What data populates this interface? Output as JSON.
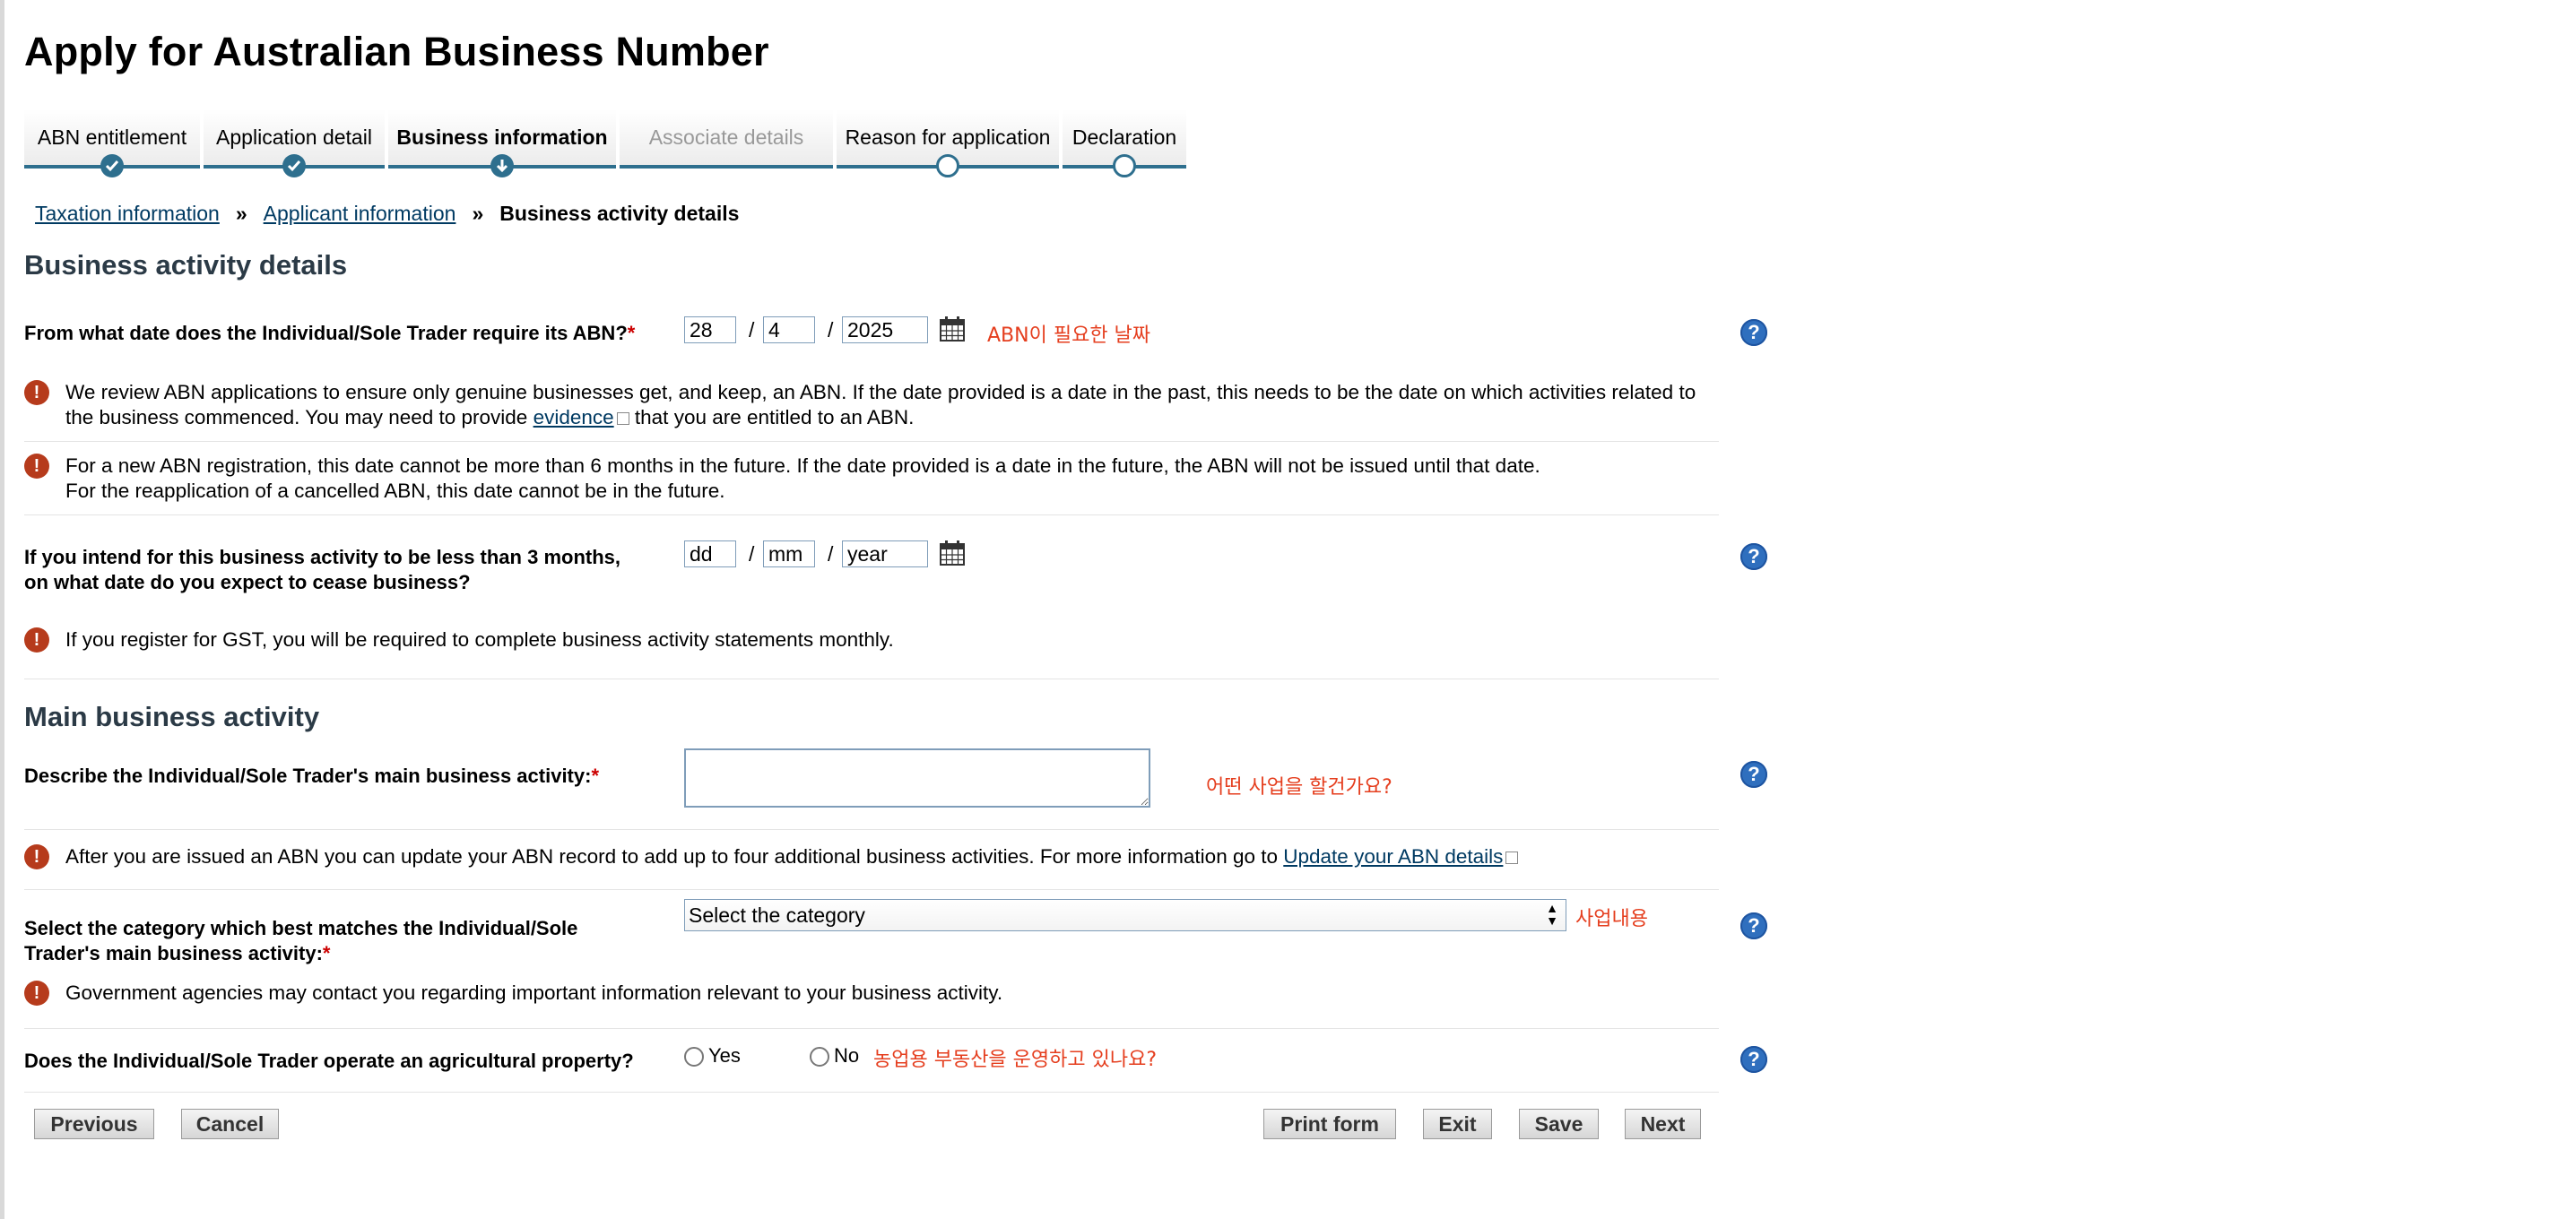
{
  "page": {
    "title": "Apply for Australian Business Number"
  },
  "steps": [
    {
      "label": "ABN entitlement",
      "state": "done"
    },
    {
      "label": "Application detail",
      "state": "done"
    },
    {
      "label": "Business information",
      "state": "current"
    },
    {
      "label": "Associate details",
      "state": "disabled"
    },
    {
      "label": "Reason for application",
      "state": "todo"
    },
    {
      "label": "Declaration",
      "state": "todo"
    }
  ],
  "breadcrumb": {
    "items": [
      "Taxation information",
      "Applicant information"
    ],
    "separator": "»",
    "current": "Business activity details"
  },
  "business_activity": {
    "heading": "Business activity details",
    "start_date": {
      "label": "From what date does the Individual/Sole Trader require its ABN?",
      "required_mark": "*",
      "day": "28",
      "month": "4",
      "year": "2025",
      "separator": "/",
      "annotation": "ABN이 필요한 날짜"
    },
    "note1": {
      "line1": "We review ABN applications to ensure only genuine businesses get, and keep, an ABN. If the date provided is a date in the past, this needs to be the date on which activities related to",
      "line2_before": "the business commenced. You may need to provide ",
      "link": "evidence",
      "line2_after": " that you are entitled to an ABN."
    },
    "note2": {
      "line1": "For a new ABN registration, this date cannot be more than 6 months in the future. If the date provided is a date in the future, the ABN will not be issued until that date.",
      "line2": "For the reapplication of a cancelled ABN, this date cannot be in the future."
    },
    "cease_date": {
      "label_line1": "If you intend for this business activity to be less than 3 months,",
      "label_line2": "on what date do you expect to cease business?",
      "day_placeholder": "dd",
      "month_placeholder": "mm",
      "year_placeholder": "year"
    },
    "note3": "If you register for GST, you will be required to complete business activity statements monthly."
  },
  "main_activity": {
    "heading": "Main business activity",
    "describe": {
      "label": "Describe the Individual/Sole Trader's main business activity:",
      "required_mark": "*",
      "value": "",
      "annotation": "어떤 사업을 할건가요?"
    },
    "note4": {
      "before": "After you are issued an ABN you can update your ABN record to add up to four additional business activities. For more information go to ",
      "link": "Update your ABN details"
    },
    "category": {
      "label_line1": "Select the category which best matches the Individual/Sole",
      "label_line2": "Trader's main business activity:",
      "required_mark": "*",
      "selected": "Select the category",
      "annotation": "사업내용"
    },
    "note5": "Government agencies may contact you regarding important information relevant to your business activity.",
    "agricultural": {
      "label": "Does the Individual/Sole Trader operate an agricultural property?",
      "yes": "Yes",
      "no": "No",
      "annotation": "농업용 부동산을 운영하고 있나요?"
    }
  },
  "buttons": {
    "previous": "Previous",
    "cancel": "Cancel",
    "print": "Print form",
    "exit": "Exit",
    "save": "Save",
    "next": "Next"
  },
  "icons": {
    "help": "help-icon",
    "warning": "warning-icon",
    "calendar": "calendar-icon",
    "external": "external-link-icon"
  },
  "colors": {
    "accent": "#2e6f8e",
    "annotation": "#e53e1e",
    "help": "#2f6fbe",
    "warning": "#b63b1c",
    "required": "#cc0000"
  }
}
